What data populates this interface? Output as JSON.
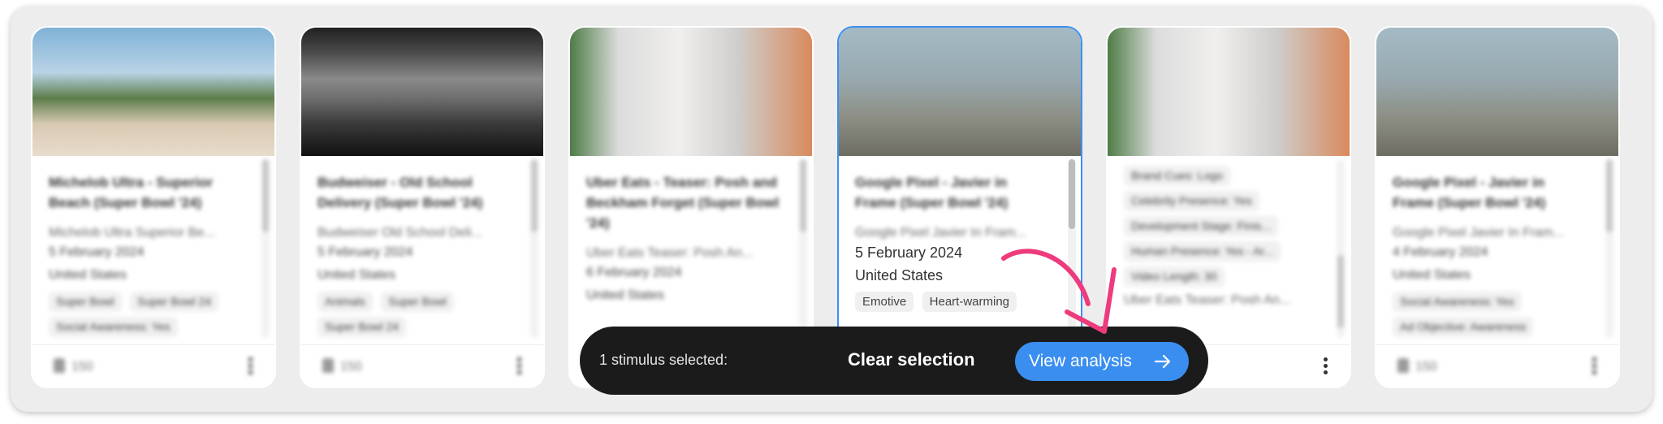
{
  "cards": [
    {
      "title": "Michelob Ultra - Superior Beach (Super Bowl '24)",
      "subtitle": "Michelob Ultra Superior Be...",
      "date": "5 February 2024",
      "country": "United States",
      "tags": [
        "Super Bowl",
        "Super Bowl 24",
        "Social Awareness: Yes"
      ],
      "likes": "150",
      "image": "beach-scene"
    },
    {
      "title": "Budweiser - Old School Delivery (Super Bowl '24)",
      "subtitle": "Budweiser Old School Deli...",
      "date": "5 February 2024",
      "country": "United States",
      "tags": [
        "Animals",
        "Super Bowl",
        "Super Bowl 24"
      ],
      "likes": "150",
      "image": "snowy-landscape"
    },
    {
      "title": "Uber Eats - Teaser: Posh and Beckham Forget (Super Bowl '24)",
      "subtitle": "Uber Eats Teaser: Posh An...",
      "date": "6 February 2024",
      "country": "United States",
      "tags": [],
      "likes": "",
      "image": "living-room"
    },
    {
      "title": "Google Pixel - Javier in Frame (Super Bowl '24)",
      "subtitle": "Google Pixel Javier In Fram...",
      "date": "5 February 2024",
      "country": "United States",
      "tags": [
        "Emotive",
        "Heart-warming"
      ],
      "likes": "",
      "image": "hazy-sky",
      "selected": true
    },
    {
      "title": "",
      "subtitle": "",
      "date": "",
      "country": "",
      "tags": [
        "Brand Cues: Logo",
        "Celebrity Presence: Yes",
        "Development Stage: Finis...",
        "Human Presence: Yes - Ar...",
        "Video Length: 30",
        "Uber Eats Teaser: Posh An..."
      ],
      "likes": "",
      "image": "living-room"
    },
    {
      "title": "Google Pixel - Javier in Frame (Super Bowl '24)",
      "subtitle": "Google Pixel Javier In Fram...",
      "date": "4 February 2024",
      "country": "United States",
      "tags": [
        "Social Awareness: Yes",
        "Ad Objective: Awareness"
      ],
      "likes": "150",
      "image": "hazy-sky"
    }
  ],
  "action_bar": {
    "selected_text": "1 stimulus selected:",
    "clear_label": "Clear selection",
    "view_label": "View analysis"
  },
  "colors": {
    "accent": "#3a8ef0",
    "bar_background": "#1b1b1b",
    "annotation": "#ee3b7d"
  }
}
